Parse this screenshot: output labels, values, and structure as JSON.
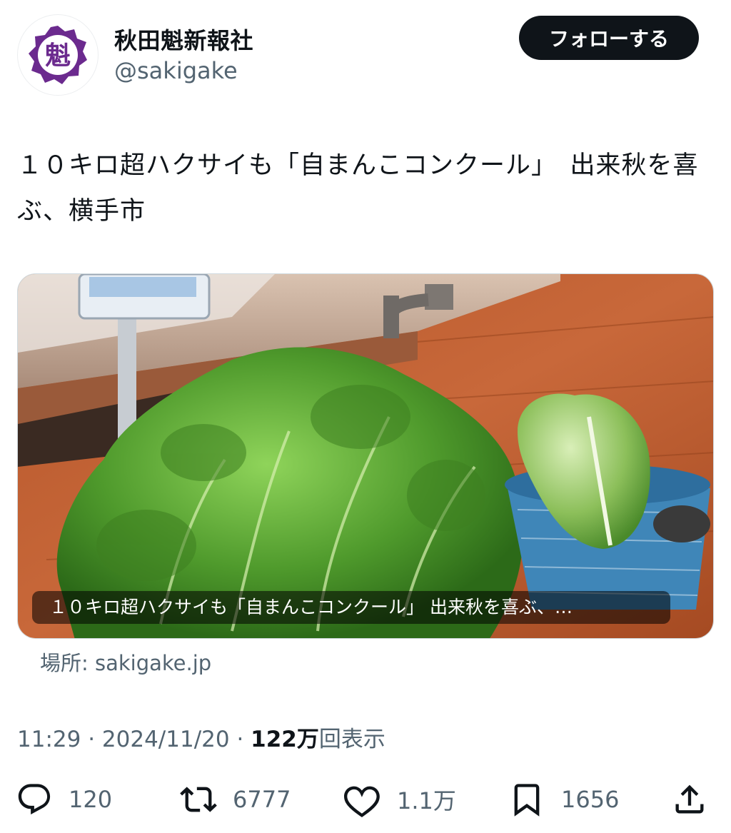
{
  "account": {
    "name": "秋田魁新報社",
    "handle": "@sakigake",
    "avatar_glyph": "魁",
    "avatar_color": "#6b2a8e"
  },
  "follow_button": {
    "label": "フォローする"
  },
  "tweet": {
    "text": "１０キロ超ハクサイも「自まんこコンクール」　出来秋を喜ぶ、横手市"
  },
  "link_card": {
    "title": "１０キロ超ハクサイも「自まんこコンクール」 出来秋を喜ぶ、…",
    "source": "場所: sakigake.jp"
  },
  "meta": {
    "time": "11:29",
    "separator": " · ",
    "date": "2024/11/20",
    "views_number": "122万",
    "views_label": "回表示"
  },
  "actions": {
    "reply": {
      "icon": "reply-icon",
      "count": "120"
    },
    "retweet": {
      "icon": "retweet-icon",
      "count": "6777"
    },
    "like": {
      "icon": "heart-icon",
      "count": "1.1万"
    },
    "bookmark": {
      "icon": "bookmark-icon",
      "count": "1656"
    },
    "share": {
      "icon": "share-icon"
    }
  },
  "colors": {
    "text": "#0f1419",
    "secondary": "#536471",
    "follow_bg": "#0f1419"
  }
}
